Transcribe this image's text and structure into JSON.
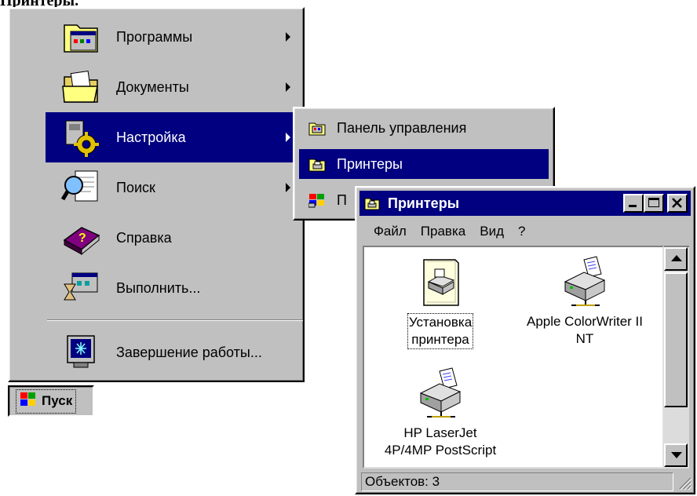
{
  "caption": "Принтеры.",
  "start_menu": {
    "items": [
      {
        "label": "Программы",
        "icon": "programs-icon",
        "has_submenu": true
      },
      {
        "label": "Документы",
        "icon": "documents-icon",
        "has_submenu": true
      },
      {
        "label": "Настройка",
        "icon": "settings-icon",
        "has_submenu": true,
        "selected": true
      },
      {
        "label": "Поиск",
        "icon": "search-icon",
        "has_submenu": true
      },
      {
        "label": "Справка",
        "icon": "help-icon",
        "has_submenu": false
      },
      {
        "label": "Выполнить...",
        "icon": "run-icon",
        "has_submenu": false
      }
    ],
    "shutdown_label": "Завершение работы..."
  },
  "start_button": {
    "label": "Пуск"
  },
  "settings_submenu": {
    "items": [
      {
        "label": "Панель управления",
        "icon": "control-panel-icon"
      },
      {
        "label": "Принтеры",
        "icon": "printers-folder-icon",
        "selected": true
      },
      {
        "label": "П",
        "icon": "taskbar-icon"
      }
    ]
  },
  "printers_window": {
    "title": "Принтеры",
    "menu": [
      "Файл",
      "Правка",
      "Вид",
      "?"
    ],
    "items": [
      {
        "label_line1": "Установка",
        "label_line2": "принтера",
        "icon": "add-printer-icon"
      },
      {
        "label_line1": "Apple ColorWriter II",
        "label_line2": "NT",
        "icon": "printer-icon"
      },
      {
        "label_line1": "HP LaserJet",
        "label_line2": "4P/4MP PostScript",
        "icon": "printer-icon"
      }
    ],
    "status": "Объектов: 3"
  },
  "colors": {
    "highlight": "#000080",
    "face": "#c0c0c0"
  }
}
